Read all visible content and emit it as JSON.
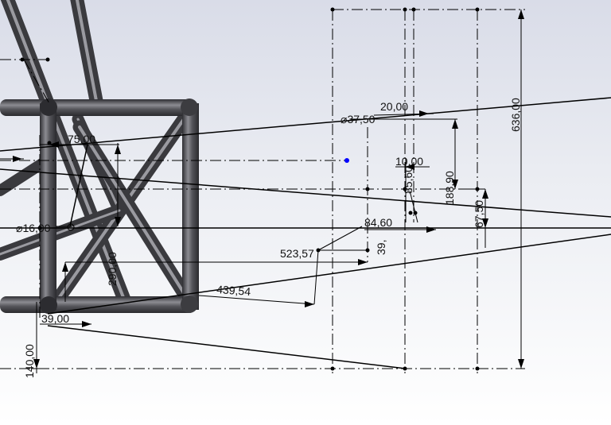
{
  "dimensions": {
    "d_37_50": "37,50",
    "d_20_00": "20,00",
    "d_75_00": "75,00",
    "d_10_00": "10,00",
    "d_188_90": "188,90",
    "d_636_00": "636,00",
    "d_85_60": "85,60",
    "d_67_50": "67,50",
    "d_84_60": "84,60",
    "d_16_00": "16,00",
    "d_39_a": "39,",
    "d_523_57": "523,57",
    "d_290_00": "290,00",
    "d_439_54": "439,54",
    "d_39_00": "39,00",
    "d_140_00": "140,00"
  },
  "symbols": {
    "diameter": "⌀"
  },
  "colors": {
    "background_top": "#d9dce8",
    "background_bottom": "#ffffff",
    "tube_fill": "#4a4a4e",
    "tube_highlight": "#9a9aa0",
    "sketch_line": "#000000",
    "selected_point": "#0000ff"
  }
}
